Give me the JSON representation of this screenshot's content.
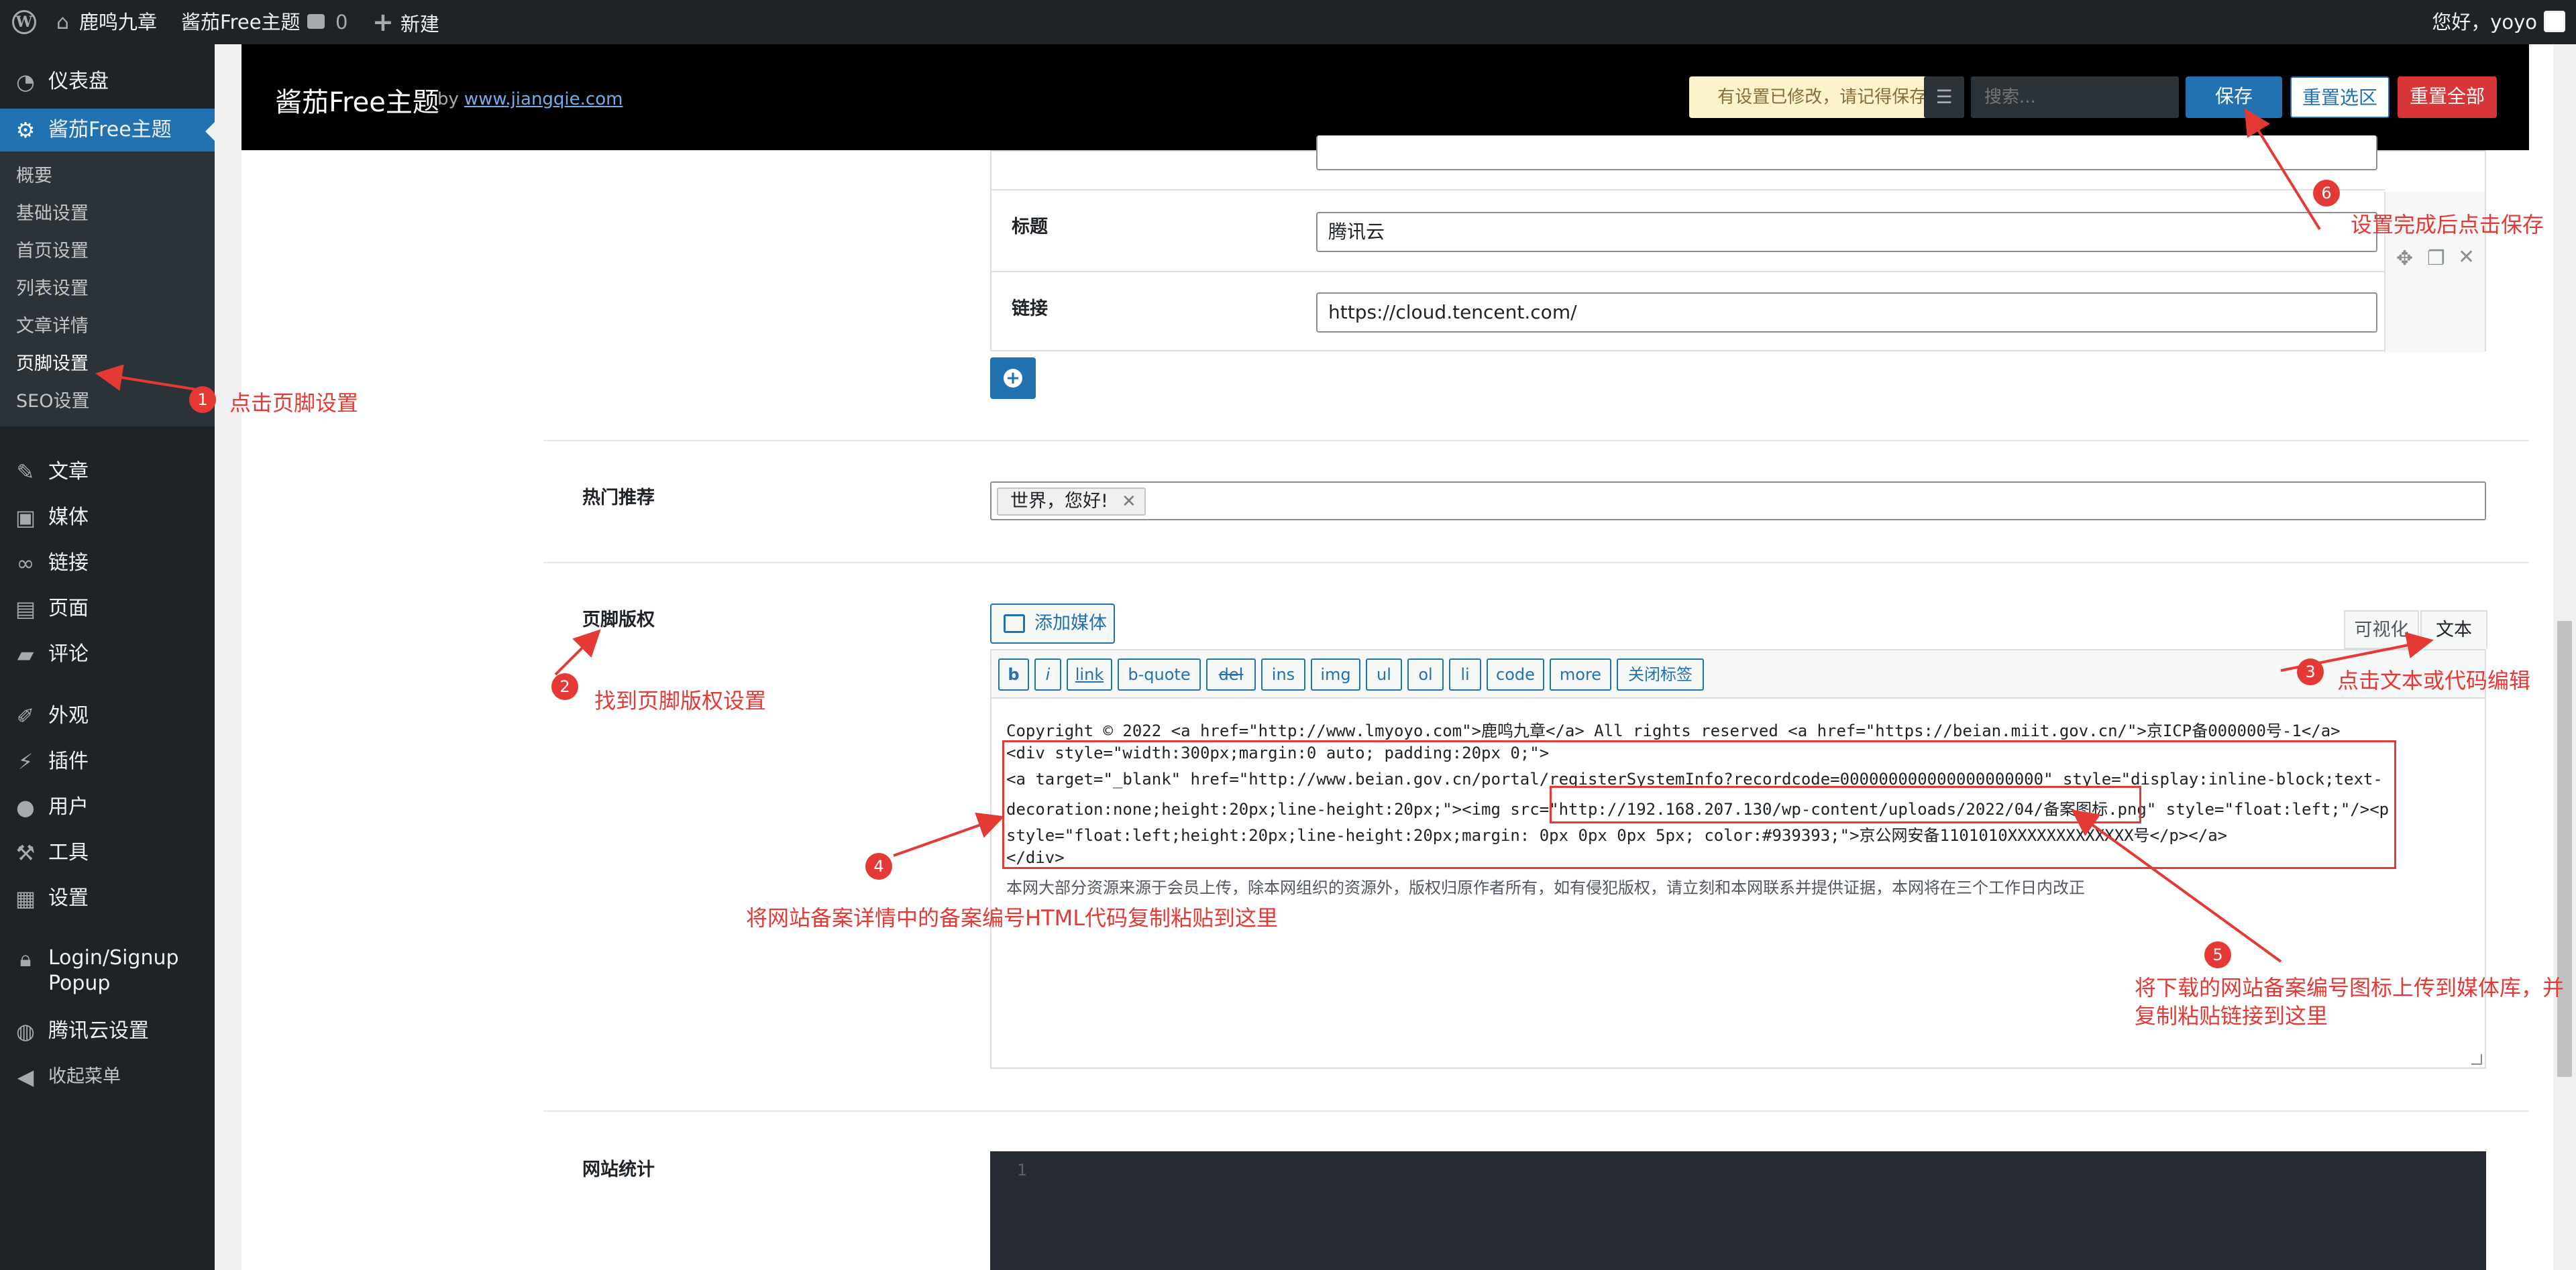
{
  "admin_bar": {
    "site_name": "鹿鸣九章",
    "theme_name": "酱茄Free主题",
    "comments_count": "0",
    "new_label": "新建",
    "greeting": "您好，yoyo"
  },
  "sidebar": {
    "dashboard": "仪表盘",
    "theme": "酱茄Free主题",
    "submenu": [
      "概要",
      "基础设置",
      "首页设置",
      "列表设置",
      "文章详情",
      "页脚设置",
      "SEO设置"
    ],
    "posts": "文章",
    "media": "媒体",
    "links": "链接",
    "pages": "页面",
    "comments": "评论",
    "appearance": "外观",
    "plugins": "插件",
    "users": "用户",
    "tools": "工具",
    "settings": "设置",
    "login_signup_1": "Login/Signup",
    "login_signup_2": "Popup",
    "tencent": "腾讯云设置",
    "collapse": "收起菜单"
  },
  "header": {
    "title": "酱茄Free主题",
    "by": "by",
    "link": "www.jiangqie.com",
    "notice": "有设置已修改，请记得保存!",
    "search_placeholder": "搜索...",
    "save": "保存",
    "reset_selection": "重置选区",
    "reset_all": "重置全部"
  },
  "links_group": {
    "title_label": "标题",
    "title_value": "腾讯云",
    "link_label": "链接",
    "link_value": "https://cloud.tencent.com/"
  },
  "hot": {
    "label": "热门推荐",
    "tag": "世界，您好!"
  },
  "copyright": {
    "label": "页脚版权",
    "add_media": "添加媒体",
    "tab_visual": "可视化",
    "tab_text": "文本",
    "quicktags": [
      "b",
      "i",
      "link",
      "b-quote",
      "del",
      "ins",
      "img",
      "ul",
      "ol",
      "li",
      "code",
      "more",
      "关闭标签"
    ],
    "code_lines": [
      "Copyright © 2022 <a href=\"http://www.lmyoyo.com\">鹿鸣九章</a> All rights reserved <a href=\"https://beian.miit.gov.cn/\">京ICP备000000号-1</a>",
      "<div style=\"width:300px;margin:0 auto; padding:20px 0;\">",
      "<a target=\"_blank\" href=\"http://www.beian.gov.cn/portal/registerSystemInfo?recordcode=000000000000000000000\" style=\"display:inline-block;text-",
      "decoration:none;height:20px;line-height:20px;\"><img src=\"http://192.168.207.130/wp-content/uploads/2022/04/备案图标.png\" style=\"float:left;\"/><p",
      "style=\"float:left;height:20px;line-height:20px;margin: 0px 0px 0px 5px; color:#939393;\">京公网安备1101010XXXXXXXXXXXXX号</p></a>",
      "</div>",
      "本网大部分资源来源于会员上传，除本网组织的资源外，版权归原作者所有，如有侵犯版权，请立刻和本网联系并提供证据，本网将在三个工作日内改正"
    ]
  },
  "stats": {
    "label": "网站统计",
    "line_number": "1"
  },
  "annotations": {
    "n1": "1",
    "t1": "点击页脚设置",
    "n2": "2",
    "t2": "找到页脚版权设置",
    "n3": "3",
    "t3": "点击文本或代码编辑",
    "n4": "4",
    "t4": "将网站备案详情中的备案编号HTML代码复制粘贴到这里",
    "n5": "5",
    "t5a": "将下载的网站备案编号图标上传到媒体库，并",
    "t5b": "复制粘贴链接到这里",
    "n6": "6",
    "t6": "设置完成后点击保存",
    "color": "#e53935"
  },
  "colors": {
    "admin_dark": "#1d2327",
    "accent_blue": "#2271b1",
    "danger_red": "#d63638",
    "notice_bg": "#fcf3cd"
  }
}
